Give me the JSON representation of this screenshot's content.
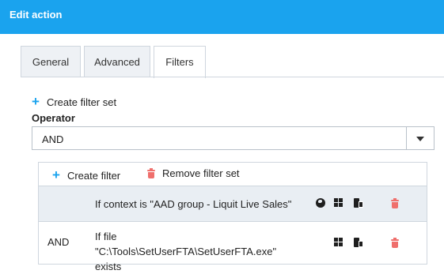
{
  "header": {
    "title": "Edit action"
  },
  "tabs": [
    {
      "label": "General",
      "active": false
    },
    {
      "label": "Advanced",
      "active": false
    },
    {
      "label": "Filters",
      "active": true
    }
  ],
  "filters": {
    "create_filter_set_label": "Create filter set",
    "operator_label": "Operator",
    "operator_value": "AND",
    "panel": {
      "create_filter_label": "Create filter",
      "remove_filter_set_label": "Remove filter set",
      "rows": [
        {
          "operator": "",
          "description": "If context is \"AAD group - Liquit Live Sales\"",
          "icons": [
            "globe-icon",
            "windows-icon",
            "device-icon"
          ]
        },
        {
          "operator": "AND",
          "description": "If file \"C:\\Tools\\SetUserFTA\\SetUserFTA.exe\" exists",
          "icons": [
            "windows-icon",
            "device-icon"
          ]
        }
      ]
    }
  },
  "colors": {
    "accent": "#1aa3ee",
    "danger": "#ef6f6c",
    "row_highlight": "#e9eef3"
  }
}
